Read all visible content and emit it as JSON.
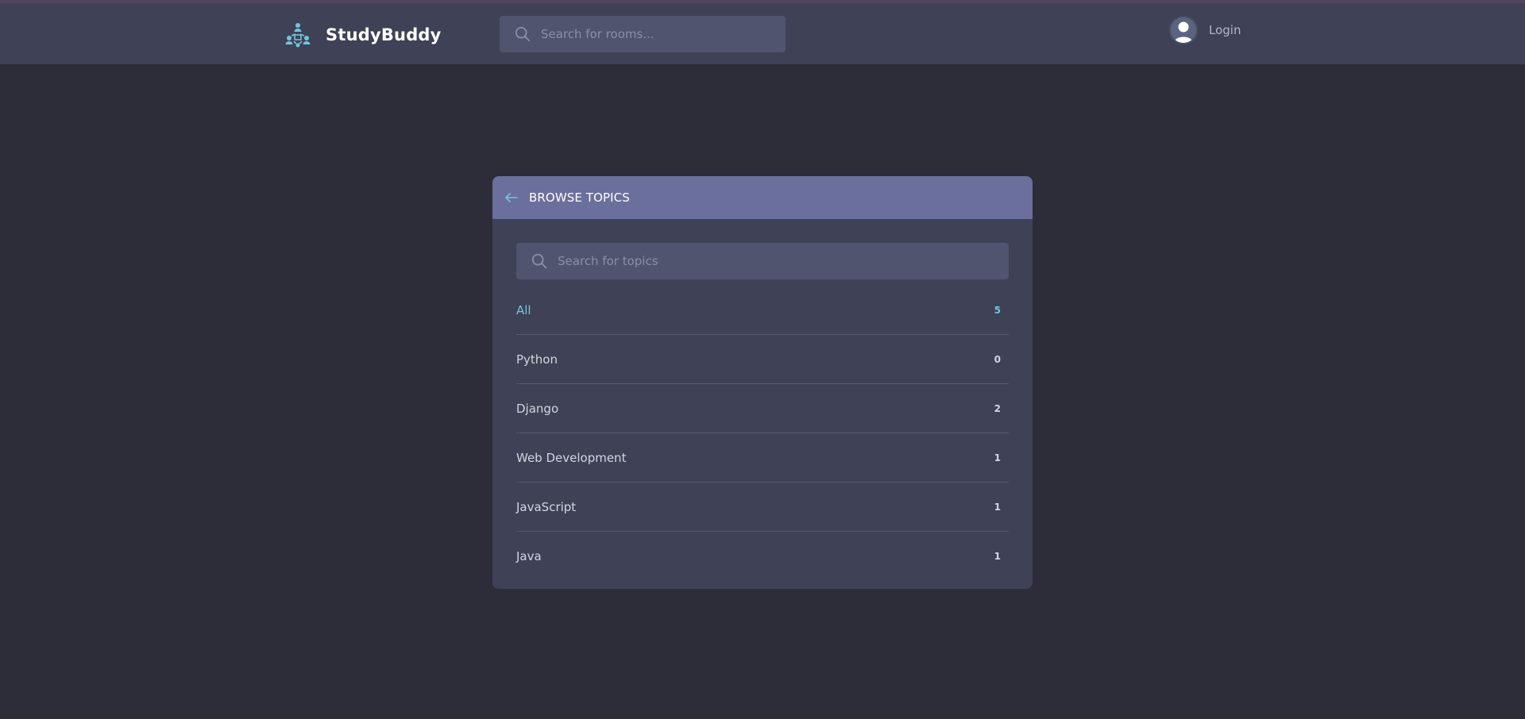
{
  "colors": {
    "background": "#2d2d39",
    "header": "#3f4156",
    "panel_header": "#6b6f9b",
    "accent": "#71c6dd"
  },
  "header": {
    "brand": "StudyBuddy",
    "logo_icon": "people-network-icon",
    "search_placeholder": "Search for rooms...",
    "login_label": "Login",
    "avatar_icon": "user-avatar-icon"
  },
  "panel": {
    "title": "BROWSE TOPICS",
    "back_icon": "arrow-left-icon",
    "search_placeholder": "Search for topics",
    "topics": [
      {
        "name": "All",
        "count": "5",
        "active": true
      },
      {
        "name": "Python",
        "count": "0"
      },
      {
        "name": "Django",
        "count": "2"
      },
      {
        "name": "Web Development",
        "count": "1"
      },
      {
        "name": "JavaScript",
        "count": "1"
      },
      {
        "name": "Java",
        "count": "1"
      }
    ]
  }
}
